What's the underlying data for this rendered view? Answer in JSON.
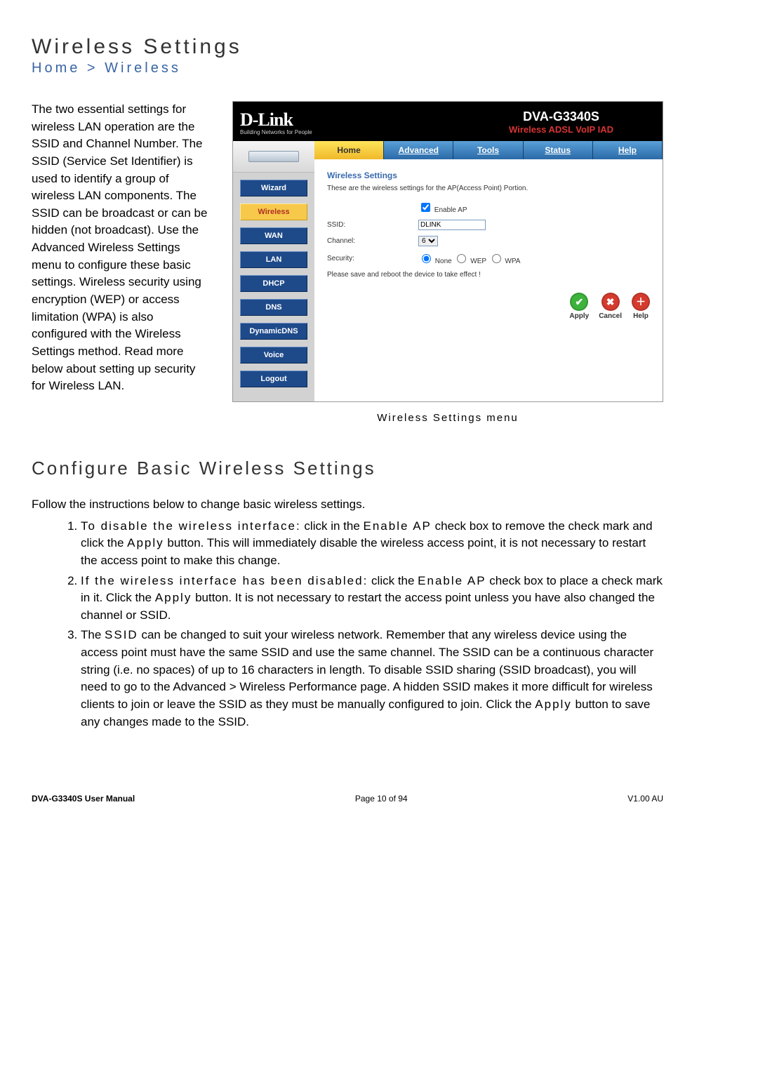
{
  "page": {
    "title": "Wireless Settings",
    "breadcrumb": "Home > Wireless",
    "intro": "The two essential settings for wireless LAN operation are the SSID and Channel Number. The SSID (Service Set Identifier) is used to identify a group of wireless LAN components. The SSID can be broadcast or can be hidden (not broadcast). Use the Advanced Wireless Settings menu to configure these basic settings. Wireless security using encryption (WEP) or access limitation (WPA) is also configured with the Wireless Settings method. Read more below about setting up security for Wireless LAN.",
    "caption": "Wireless Settings menu",
    "section2_title": "Configure Basic Wireless Settings",
    "section2_lead": "Follow the instructions below to change basic wireless settings."
  },
  "router": {
    "brand": "D-Link",
    "brand_sub": "Building Networks for People",
    "model": "DVA-G3340S",
    "model_sub": "Wireless ADSL VoIP IAD",
    "tabs": [
      "Home",
      "Advanced",
      "Tools",
      "Status",
      "Help"
    ],
    "active_tab": "Home",
    "side": [
      "Wizard",
      "Wireless",
      "WAN",
      "LAN",
      "DHCP",
      "DNS",
      "DynamicDNS",
      "Voice",
      "Logout"
    ],
    "active_side": "Wireless",
    "panel_title": "Wireless Settings",
    "panel_desc": "These are the wireless settings for the AP(Access Point) Portion.",
    "enable_ap_label": "Enable AP",
    "enable_ap_checked": true,
    "ssid_label": "SSID:",
    "ssid_value": "DLINK",
    "channel_label": "Channel:",
    "channel_value": "6",
    "security_label": "Security:",
    "security_options": [
      "None",
      "WEP",
      "WPA"
    ],
    "security_selected": "None",
    "reboot_note": "Please save and reboot the device to take effect !",
    "actions": {
      "apply": "Apply",
      "cancel": "Cancel",
      "help": "Help"
    }
  },
  "steps": {
    "s1_bold": "To disable the wireless interface:",
    "s1_rest_a": " click in the ",
    "s1_enable": "Enable AP",
    "s1_rest_b": " check box to remove the check mark and click the ",
    "s1_apply": "Apply",
    "s1_rest_c": " button. This will immediately disable the wireless access point, it is not necessary to restart the access point to make this change.",
    "s2_bold": "If the wireless interface has been disabled:",
    "s2_rest_a": " click the ",
    "s2_enable": "Enable AP",
    "s2_rest_b": " check box to place a check mark in it. Click the ",
    "s2_apply": "Apply",
    "s2_rest_c": " button. It is not necessary to restart the access point unless you have also changed the channel or SSID.",
    "s3_a": "The ",
    "s3_ssid": "SSID",
    "s3_b": " can be changed to suit your wireless network. Remember that any wireless device using the access point must have the same SSID and use the same channel. The SSID can be a continuous character string (i.e. no spaces) of up to 16 characters in length. To disable SSID sharing (SSID broadcast), you will need to go to the Advanced > Wireless Performance page. A hidden SSID makes it more difficult for wireless clients to join or leave the SSID as they must be manually configured to join. Click the ",
    "s3_apply": "Apply",
    "s3_c": " button to save any changes made to the SSID."
  },
  "footer": {
    "left": "DVA-G3340S User Manual",
    "center": "Page 10 of 94",
    "right": "V1.00 AU"
  }
}
